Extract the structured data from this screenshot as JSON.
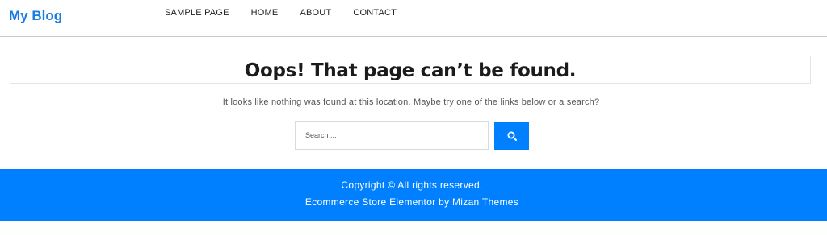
{
  "header": {
    "logo": "My Blog",
    "nav": [
      "SAMPLE PAGE",
      "HOME",
      "ABOUT",
      "CONTACT"
    ]
  },
  "main": {
    "title": "Oops! That page can’t be found.",
    "message": "It looks like nothing was found at this location. Maybe try one of the links below or a search?",
    "search": {
      "placeholder": "Search ...",
      "value": ""
    }
  },
  "footer": {
    "copyright": "Copyright ©  All rights reserved.",
    "credit": "Ecommerce Store Elementor by Mizan Themes"
  },
  "colors": {
    "accent": "#0080ff",
    "logo": "#1a7be0"
  },
  "icons": {
    "search_button": "search-icon"
  }
}
